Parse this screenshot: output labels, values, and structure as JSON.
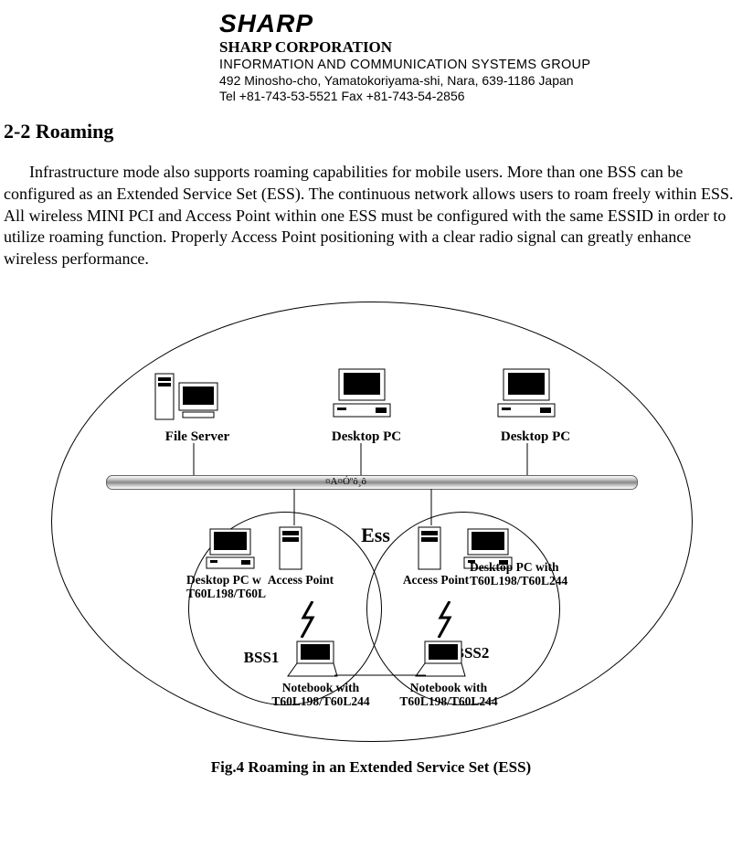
{
  "header": {
    "logo": "SHARP",
    "corp": "SHARP CORPORATION",
    "group": "INFORMATION AND COMMUNICATION SYSTEMS GROUP",
    "address": "492 Minosho-cho, Yamatokoriyama-shi, Nara, 639-1186 Japan",
    "tel": "Tel +81-743-53-5521 Fax +81-743-54-2856"
  },
  "section": {
    "title": "2-2 Roaming",
    "body": "Infrastructure mode also supports roaming capabilities for mobile users. More than one BSS can be configured as an Extended Service Set (ESS). The continuous network allows users to roam freely within ESS. All wireless MINI PCI and Access Point within one ESS must be configured with the same ESSID in order to utilize roaming function. Properly Access Point positioning with a clear radio signal can greatly enhance wireless performance."
  },
  "figure": {
    "cable_text": "¤A¤Óºô¸ô",
    "file_server": "File Server",
    "desktop_pc": "Desktop PC",
    "ess": "Ess",
    "bss1": "BSS1",
    "bss2": "BSS2",
    "access_point": "Access Point",
    "desktop_with_l1": "Desktop PC w",
    "desktop_with_l2": "T60L198/T60L",
    "desktop_with2_l1": "Desktop PC with",
    "desktop_with2_l2": "T60L198/T60L244",
    "notebook_l1": "Notebook with",
    "notebook_l2": "T60L198/T60L244",
    "caption": "Fig.4 Roaming in an Extended Service Set (ESS)"
  }
}
